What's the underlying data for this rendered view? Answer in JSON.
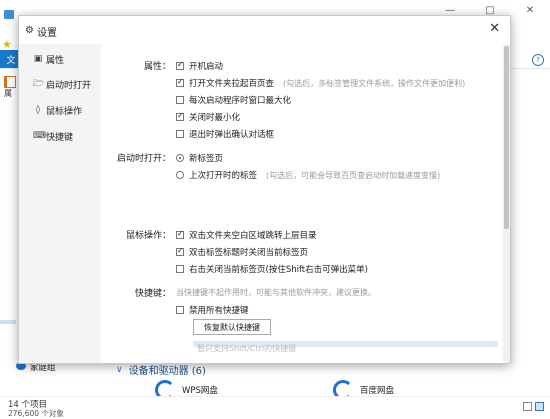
{
  "explorer": {
    "ribbon_file": "文",
    "left_edge_text": "属",
    "homegroup": "家庭组",
    "section_title": "设备和驱动器 (6)",
    "drives": [
      "WPS网盘",
      "百度网盘"
    ],
    "status_count": "14 个项目",
    "status_selection": "276,600 个对象"
  },
  "dialog": {
    "title": "设置",
    "nav": [
      {
        "label": "属性",
        "icon": "window-icon"
      },
      {
        "label": "启动时打开",
        "icon": "folder-open-icon"
      },
      {
        "label": "鼠标操作",
        "icon": "mouse-icon"
      },
      {
        "label": "快捷键",
        "icon": "keyboard-icon"
      }
    ],
    "sections": {
      "properties": {
        "label": "属性：",
        "options": [
          {
            "label": "开机启动",
            "checked": true,
            "hint": ""
          },
          {
            "label": "打开文件夹拉起百页查",
            "checked": true,
            "hint": "(勾选后，多标签管理文件系统，操作文件更加便利)"
          },
          {
            "label": "每次启动程序时窗口最大化",
            "checked": false,
            "hint": ""
          },
          {
            "label": "关闭时最小化",
            "checked": true,
            "hint": ""
          },
          {
            "label": "退出时弹出确认对话框",
            "checked": false,
            "hint": ""
          }
        ]
      },
      "startup": {
        "label": "启动时打开：",
        "options": [
          {
            "label": "新标签页",
            "selected": true,
            "hint": ""
          },
          {
            "label": "上次打开时的标签",
            "selected": false,
            "hint": "(勾选后，可能会导致百页查启动时加载速度变慢)"
          }
        ]
      },
      "mouse": {
        "label": "鼠标操作：",
        "options": [
          {
            "label": "双击文件夹空白区域跳转上层目录",
            "checked": true
          },
          {
            "label": "双击标签标题时关闭当前标签页",
            "checked": true
          },
          {
            "label": "右击关闭当前标签页(按住Shift右击可弹出菜单)",
            "checked": false
          }
        ]
      },
      "shortcuts": {
        "label": "快捷键：",
        "hint": "当快捷键不起作用时，可能与其他软件冲突，建议更换。",
        "disable_all": "禁用所有快捷键",
        "disable_all_checked": false,
        "reset_button": "恢复默认快捷键",
        "note": "暂只支持Shift/Ctrl的快捷键"
      }
    }
  }
}
